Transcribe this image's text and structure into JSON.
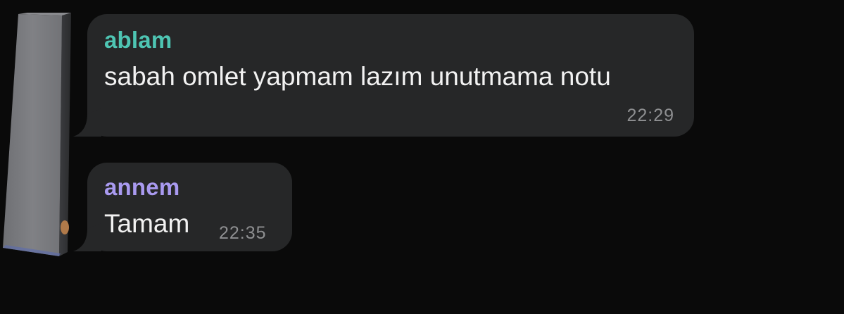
{
  "messages": [
    {
      "sender": "ablam",
      "sender_color": "#4ec5b3",
      "text": "sabah omlet yapmam lazım unutmama notu",
      "time": "22:29"
    },
    {
      "sender": "annem",
      "sender_color": "#a99af0",
      "text": "Tamam",
      "time": "22:35"
    }
  ],
  "colors": {
    "background": "#0a0a0a",
    "bubble": "#262728",
    "message_text": "#f2f2f2",
    "timestamp": "#8e8f91"
  }
}
